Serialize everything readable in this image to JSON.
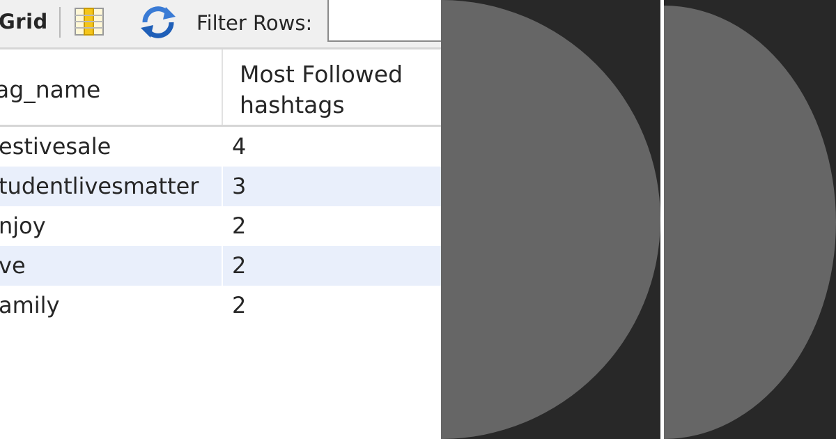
{
  "toolbar": {
    "grid_label": "Grid",
    "columns_icon": "columns-icon",
    "refresh_icon": "refresh-icon",
    "filter_label": "Filter Rows:",
    "filter_value": ""
  },
  "table": {
    "columns": [
      "shtag_name",
      "Most Followed\nhashtags"
    ],
    "column_1_header": "shtag_name",
    "column_2_header_line1": "Most Followed",
    "column_2_header_line2": "hashtags",
    "rows": [
      {
        "hashtag_name": "estivesale",
        "count": "4"
      },
      {
        "hashtag_name": "tudentlivesmatter",
        "count": "3"
      },
      {
        "hashtag_name": "njoy",
        "count": "2"
      },
      {
        "hashtag_name": "ve",
        "count": "2"
      },
      {
        "hashtag_name": "amily",
        "count": "2"
      }
    ]
  },
  "colors": {
    "toolbar_bg": "#f0f0f0",
    "alt_row_bg": "#e9effb",
    "dark_panel_bg": "#282828",
    "disc_gray": "#666666"
  }
}
